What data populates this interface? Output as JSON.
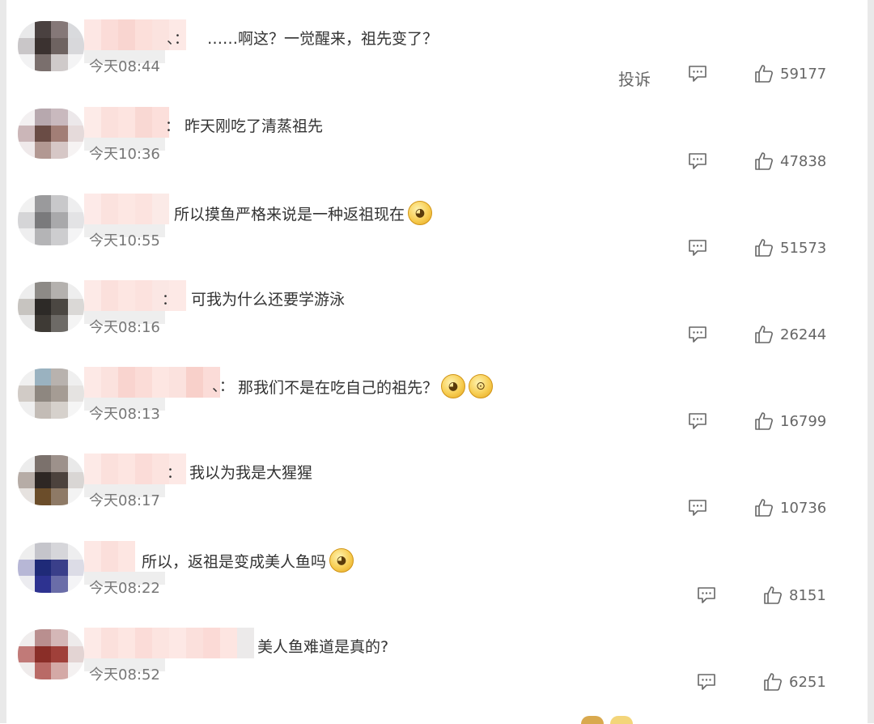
{
  "actions": {
    "report_label": "投诉"
  },
  "comments": [
    {
      "separator": "、：",
      "text": "……啊这？一觉醒来，祖先变了？",
      "emojis": [],
      "time": "今天08:44",
      "likes": "59177",
      "avatar": [
        "#e9e9ea",
        "#4a4140",
        "#857878",
        "#d9dadd",
        "#c9c6c8",
        "#3b3230",
        "#6e6361",
        "#d8d8db",
        "#f2f2f3",
        "#7a6f6d",
        "#cfcaca",
        "#f4f4f5"
      ],
      "name": [
        "#fde7e4",
        "#fbdcd8",
        "#f9d5d0",
        "#fcdfda",
        "#fbe3df",
        "#fde9e6"
      ]
    },
    {
      "separator": "：",
      "text": "昨天刚吃了清蒸祖先",
      "emojis": [],
      "time": "今天10:36",
      "likes": "47838",
      "avatar": [
        "#f3f0f1",
        "#b7a8ae",
        "#c9b9be",
        "#ece8ea",
        "#cbb6b8",
        "#6a4c45",
        "#a27e76",
        "#e5dada",
        "#efe9ea",
        "#b29892",
        "#d6c7c6",
        "#f6f3f3"
      ],
      "name": [
        "#fdebe8",
        "#fbe0dc",
        "#fde4e0",
        "#f9d8d3",
        "#fcdfdb"
      ]
    },
    {
      "separator": "",
      "text": "所以摸鱼严格来说是一种返祖现在",
      "emojis": [
        "doge"
      ],
      "time": "今天10:55",
      "likes": "51573",
      "avatar": [
        "#f1f1f1",
        "#9a9a9c",
        "#c8c8ca",
        "#eeeeef",
        "#d5d5d7",
        "#7a7a7c",
        "#a9a9ab",
        "#e3e3e5",
        "#eeeeef",
        "#b4b4b6",
        "#cdcdcf",
        "#f4f4f5"
      ],
      "name": [
        "#fdeae8",
        "#fbe2de",
        "#fde7e3",
        "#fce3df",
        "#fbeae7"
      ]
    },
    {
      "separator": "：",
      "text": "可我为什么还要学游泳",
      "emojis": [],
      "time": "今天08:16",
      "likes": "26244",
      "avatar": [
        "#ededed",
        "#8d8a86",
        "#b4b1ae",
        "#eeeeee",
        "#c7c4c0",
        "#2d2a27",
        "#4b4742",
        "#dad8d6",
        "#e8e8e8",
        "#3e3a35",
        "#6d6a66",
        "#f4f4f4"
      ],
      "name": [
        "#fdeae7",
        "#fbe0dc",
        "#fde6e2",
        "#fce2de",
        "#fbe7e4",
        "#fde9e6"
      ]
    },
    {
      "separator": "、：",
      "text": "那我们不是在吃自己的祖先？",
      "emojis": [
        "doge",
        "shock"
      ],
      "time": "今天08:13",
      "likes": "16799",
      "avatar": [
        "#f0f0f0",
        "#9ab2c0",
        "#b8b2ae",
        "#efefef",
        "#d1cbc6",
        "#8e8780",
        "#a59c94",
        "#e5e3e1",
        "#efefef",
        "#c3bcb6",
        "#d6d1cc",
        "#f5f5f5"
      ],
      "name": [
        "#fde9e6",
        "#fbe2de",
        "#f9d4cf",
        "#fbdcd7",
        "#fde6e2",
        "#fbe2de",
        "#f8d0ca",
        "#fbdcd8"
      ]
    },
    {
      "separator": "：",
      "text": "我以为我是大猩猩",
      "emojis": [],
      "time": "今天08:17",
      "likes": "10736",
      "avatar": [
        "#ececec",
        "#7b716c",
        "#9d918b",
        "#e9e9e9",
        "#b6aca6",
        "#2e2724",
        "#4c423d",
        "#d9d6d4",
        "#e6e2df",
        "#6b4d2a",
        "#8e7a66",
        "#f3f3f3"
      ],
      "name": [
        "#fdeae7",
        "#fbe0dc",
        "#fde5e1",
        "#fbdcd8",
        "#fce3df",
        "#fde9e6"
      ]
    },
    {
      "separator": "",
      "text": "所以，返祖是变成美人鱼吗",
      "emojis": [
        "doge"
      ],
      "time": "今天08:22",
      "likes": "8151",
      "avatar": [
        "#eeeeee",
        "#c5c5cb",
        "#d6d6da",
        "#eeeeef",
        "#b7b7d6",
        "#1f2a78",
        "#3a3f8a",
        "#dcdce6",
        "#ececf0",
        "#2d3290",
        "#6a6da8",
        "#f4f4f6"
      ],
      "name": [
        "#fde8e5",
        "#fbdfdb",
        "#fde6e2"
      ]
    },
    {
      "separator": "",
      "text": "美人鱼难道是真的?",
      "emojis": [],
      "time": "今天08:52",
      "likes": "6251",
      "avatar": [
        "#f0eded",
        "#b98f8f",
        "#d4b7b7",
        "#eeebeb",
        "#c17a78",
        "#8a2e28",
        "#a0403a",
        "#e3d4d3",
        "#efebeb",
        "#b96a66",
        "#d4a9a6",
        "#f4f1f1"
      ],
      "name": [
        "#fdeae7",
        "#fbe0dc",
        "#fde6e2",
        "#fbdcd8",
        "#fce4e0",
        "#fde8e5",
        "#fbe0dc",
        "#fbdad6",
        "#fde5e1",
        "#eceaea"
      ]
    }
  ]
}
